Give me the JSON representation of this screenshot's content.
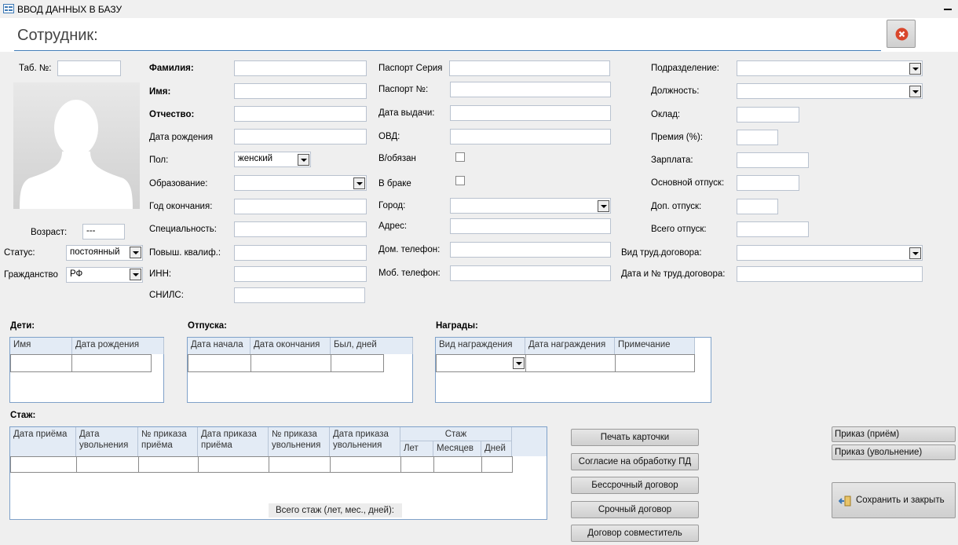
{
  "window": {
    "title": "ВВОД ДАННЫХ В БАЗУ"
  },
  "header": {
    "title": "Сотрудник:"
  },
  "left": {
    "tab_no_label": "Таб. №:",
    "age_label": "Возраст:",
    "age_value": "---",
    "status_label": "Статус:",
    "status_value": "постоянный",
    "citizenship_label": "Гражданство",
    "citizenship_value": "РФ"
  },
  "col1": {
    "surname": "Фамилия:",
    "name": "Имя:",
    "patronymic": "Отчество:",
    "birth_date": "Дата рождения",
    "sex": "Пол:",
    "sex_value": "женский",
    "education": "Образование:",
    "grad_year": "Год окончания:",
    "specialty": "Специальность:",
    "qualification": "Повыш. квалиф.:",
    "inn": "ИНН:",
    "snils": "СНИЛС:"
  },
  "col2": {
    "passport_series": "Паспорт Серия",
    "passport_no": "Паспорт №:",
    "issue_date": "Дата выдачи:",
    "ovd": "ОВД:",
    "military": "В/обязан",
    "married": "В браке",
    "city": "Город:",
    "address": "Адрес:",
    "home_phone": "Дом. телефон:",
    "mobile_phone": "Моб. телефон:"
  },
  "col3": {
    "department": "Подразделение:",
    "position": "Должность:",
    "salary_rate": "Оклад:",
    "bonus": "Премия (%):",
    "salary": "Зарплата:",
    "main_leave": "Основной отпуск:",
    "extra_leave": "Доп. отпуск:",
    "total_leave": "Всего отпуск:",
    "contract_type": "Вид труд.договора:",
    "contract_date_no": "Дата и № труд.договора:"
  },
  "children": {
    "title": "Дети:",
    "columns": [
      "Имя",
      "Дата рождения"
    ]
  },
  "vacations": {
    "title": "Отпуска:",
    "columns": [
      "Дата начала",
      "Дата окончания",
      "Был, дней"
    ]
  },
  "awards": {
    "title": "Награды:",
    "columns": [
      "Вид награждения",
      "Дата награждения",
      "Примечание"
    ]
  },
  "experience": {
    "title": "Стаж:",
    "columns": [
      "Дата приёма",
      "Дата увольнения",
      "№ приказа приёма",
      "Дата приказа приёма",
      "№ приказа увольнения",
      "Дата приказа увольнения"
    ],
    "group": "Стаж",
    "sub": [
      "Лет",
      "Месяцев",
      "Дней"
    ],
    "total": "Всего стаж (лет, мес., дней):"
  },
  "buttons": {
    "print_card": "Печать карточки",
    "consent": "Согласие на обработку ПД",
    "permanent": "Бессрочный договор",
    "fixed_term": "Срочный договор",
    "part_time": "Договор совместитель",
    "order_hire": "Приказ (приём)",
    "order_dismiss": "Приказ (увольнение)",
    "save_close": "Сохранить и закрыть"
  },
  "colors": {
    "accent": "#3c78b4",
    "close_icon": "#d9462b"
  }
}
